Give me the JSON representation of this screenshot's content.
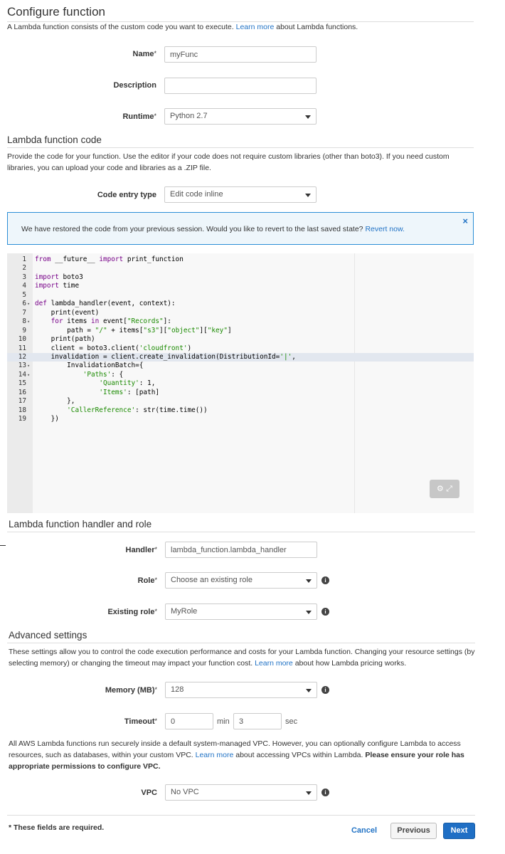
{
  "configure": {
    "title": "Configure function",
    "intro_before": "A Lambda function consists of the custom code you want to execute. ",
    "intro_link": "Learn more",
    "intro_after": " about Lambda functions.",
    "name_label": "Name",
    "name_value": "myFunc",
    "description_label": "Description",
    "description_value": "",
    "runtime_label": "Runtime",
    "runtime_value": "Python 2.7",
    "required_mark": "*"
  },
  "code": {
    "title": "Lambda function code",
    "intro": "Provide the code for your function. Use the editor if your code does not require custom libraries (other than boto3). If you need custom libraries, you can upload your code and libraries as a .ZIP file.",
    "entry_type_label": "Code entry type",
    "entry_type_value": "Edit code inline"
  },
  "alert": {
    "message": "We have restored the code from your previous session. Would you like to revert to the last saved state? ",
    "link": "Revert now.",
    "close": "×"
  },
  "editor": {
    "active_line": 12,
    "lines": [
      {
        "n": "1",
        "fold": "",
        "code": "from __future__ import print_function"
      },
      {
        "n": "2",
        "fold": "",
        "code": ""
      },
      {
        "n": "3",
        "fold": "",
        "code": "import boto3"
      },
      {
        "n": "4",
        "fold": "",
        "code": "import time"
      },
      {
        "n": "5",
        "fold": "",
        "code": ""
      },
      {
        "n": "6",
        "fold": "▾",
        "code": "def lambda_handler(event, context):"
      },
      {
        "n": "7",
        "fold": "",
        "code": "    print(event)"
      },
      {
        "n": "8",
        "fold": "▾",
        "code": "    for items in event[\"Records\"]:"
      },
      {
        "n": "9",
        "fold": "",
        "code": "        path = \"/\" + items[\"s3\"][\"object\"][\"key\"]"
      },
      {
        "n": "10",
        "fold": "",
        "code": "    print(path)"
      },
      {
        "n": "11",
        "fold": "",
        "code": "    client = boto3.client('cloudfront')"
      },
      {
        "n": "12",
        "fold": "",
        "code": "    invalidation = client.create_invalidation(DistributionId='|',"
      },
      {
        "n": "13",
        "fold": "▾",
        "code": "        InvalidationBatch={"
      },
      {
        "n": "14",
        "fold": "▾",
        "code": "            'Paths': {"
      },
      {
        "n": "15",
        "fold": "",
        "code": "                'Quantity': 1,"
      },
      {
        "n": "16",
        "fold": "",
        "code": "                'Items': [path]"
      },
      {
        "n": "17",
        "fold": "",
        "code": "        },"
      },
      {
        "n": "18",
        "fold": "",
        "code": "        'CallerReference': str(time.time())"
      },
      {
        "n": "19",
        "fold": "",
        "code": "    })"
      }
    ],
    "tools_icons": "⚙ ⤢"
  },
  "handler": {
    "title": "Lambda function handler and role",
    "handler_label": "Handler",
    "handler_value": "lambda_function.lambda_handler",
    "role_label": "Role",
    "role_value": "Choose an existing role",
    "existing_role_label": "Existing role",
    "existing_role_value": "MyRole"
  },
  "advanced": {
    "title": "Advanced settings",
    "intro_before": "These settings allow you to control the code execution performance and costs for your Lambda function. Changing your resource settings (by selecting memory) or changing the timeout may impact your function cost. ",
    "intro_link": "Learn more",
    "intro_after": " about how Lambda pricing works.",
    "memory_label": "Memory (MB)",
    "memory_value": "128",
    "timeout_label": "Timeout",
    "timeout_min": "0",
    "timeout_min_unit": "min",
    "timeout_sec": "3",
    "timeout_sec_unit": "sec",
    "vpc_text_before": "All AWS Lambda functions run securely inside a default system-managed VPC. However, you can optionally configure Lambda to access resources, such as databases, within your custom VPC. ",
    "vpc_text_link": "Learn more",
    "vpc_text_after": " about accessing VPCs within Lambda. ",
    "vpc_text_bold": "Please ensure your role has appropriate permissions to configure VPC.",
    "vpc_label": "VPC",
    "vpc_value": "No VPC"
  },
  "footer": {
    "required_note": "* These fields are required.",
    "cancel": "Cancel",
    "previous": "Previous",
    "next": "Next"
  },
  "icons": {
    "info": "i",
    "caret": "chevron-down-icon"
  },
  "colors": {
    "link": "#2273c5",
    "primary_button": "#1f6fc5",
    "alert_border": "#2b8ed6"
  }
}
